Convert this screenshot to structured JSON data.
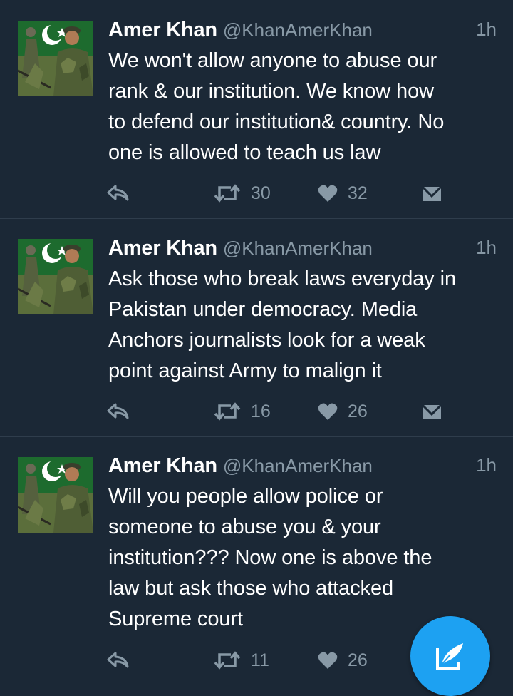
{
  "accent_color": "#1da1f2",
  "tweets": [
    {
      "name": "Amer Khan",
      "handle": "@KhanAmerKhan",
      "time": "1h",
      "lines": [
        "We won't allow anyone to abuse our",
        "rank & our institution. We know how",
        "to defend our institution& country. No",
        "one is allowed to teach us law"
      ],
      "retweets": "30",
      "likes": "32"
    },
    {
      "name": "Amer Khan",
      "handle": "@KhanAmerKhan",
      "time": "1h",
      "lines": [
        "Ask those who break laws everyday in",
        "Pakistan under democracy. Media",
        "Anchors journalists look for a weak",
        "point against Army to malign it"
      ],
      "retweets": "16",
      "likes": "26"
    },
    {
      "name": "Amer Khan",
      "handle": "@KhanAmerKhan",
      "time": "1h",
      "lines": [
        "Will you people allow police or",
        "someone to abuse you & your",
        "institution??? Now one is above the",
        "law but ask those who attacked",
        "Supreme court"
      ],
      "retweets": "11",
      "likes": "26"
    }
  ],
  "icons": {
    "reply": "reply-icon",
    "retweet": "retweet-icon",
    "like": "heart-icon",
    "dm": "direct-message-icon",
    "compose": "compose-tweet-icon"
  }
}
